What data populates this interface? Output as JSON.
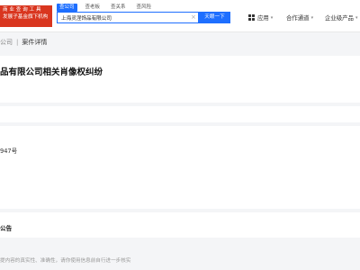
{
  "ad": {
    "lines": [
      "商 业 查 询 工 具",
      "发展子基金旗下机构"
    ]
  },
  "search": {
    "tabs": [
      "查公司",
      "查老板",
      "查关系",
      "查风险"
    ],
    "value": "上海灵涅饰品有限公司",
    "button_label": "天眼一下"
  },
  "nav": {
    "app": "应用",
    "partner": "合作通道",
    "enterprise": "企业级产品"
  },
  "breadcrumb": {
    "parent": "公司",
    "current": "案件详情"
  },
  "case": {
    "title": "品有限公司相关肖像权纠纷",
    "number_fragment": "947号",
    "notice_label": "公告"
  },
  "footer": {
    "disclaimer": "提内容的真实性、准确性，请你使用信息前自行进一步核实"
  }
}
